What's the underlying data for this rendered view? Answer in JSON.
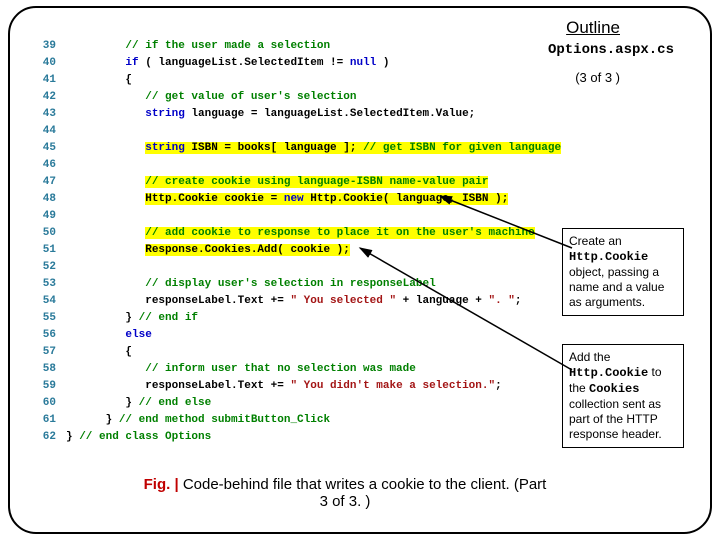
{
  "header": {
    "outline": "Outline",
    "filename": "Options.aspx.cs",
    "pageinfo": "(3 of 3 )"
  },
  "code": {
    "lines": [
      {
        "n": "39",
        "segs": [
          {
            "cls": "cmt",
            "t": "// if the user made a selection"
          }
        ],
        "indent": 3
      },
      {
        "n": "40",
        "segs": [
          {
            "cls": "kw",
            "t": "if"
          },
          {
            "cls": "plain",
            "t": " ( languageList.SelectedItem != "
          },
          {
            "cls": "kw",
            "t": "null"
          },
          {
            "cls": "plain",
            "t": " )"
          }
        ],
        "indent": 3
      },
      {
        "n": "41",
        "segs": [
          {
            "cls": "plain",
            "t": "{"
          }
        ],
        "indent": 3
      },
      {
        "n": "42",
        "segs": [
          {
            "cls": "cmt",
            "t": "// get value of user's selection"
          }
        ],
        "indent": 4
      },
      {
        "n": "43",
        "segs": [
          {
            "cls": "kw",
            "t": "string"
          },
          {
            "cls": "plain",
            "t": " language = languageList.SelectedItem.Value;"
          }
        ],
        "indent": 4
      },
      {
        "n": "44",
        "segs": [],
        "indent": 0
      },
      {
        "n": "45",
        "segs": [
          {
            "cls": "kw hl",
            "t": "string"
          },
          {
            "cls": "plain hl",
            "t": " ISBN = books[ language ]; "
          },
          {
            "cls": "cmt hl",
            "t": "// get ISBN for given language"
          }
        ],
        "indent": 4
      },
      {
        "n": "46",
        "segs": [],
        "indent": 0
      },
      {
        "n": "47",
        "segs": [
          {
            "cls": "cmt hl",
            "t": "// create cookie using language-ISBN name-value pair"
          }
        ],
        "indent": 4
      },
      {
        "n": "48",
        "segs": [
          {
            "cls": "plain hl",
            "t": "Http.Cookie cookie = "
          },
          {
            "cls": "kw hl",
            "t": "new"
          },
          {
            "cls": "plain hl",
            "t": " Http.Cookie( language, ISBN );"
          }
        ],
        "indent": 4
      },
      {
        "n": "49",
        "segs": [],
        "indent": 0
      },
      {
        "n": "50",
        "segs": [
          {
            "cls": "cmt hl",
            "t": "// add cookie to response to place it on the user's machine"
          }
        ],
        "indent": 4
      },
      {
        "n": "51",
        "segs": [
          {
            "cls": "plain hl",
            "t": "Response.Cookies.Add( cookie );"
          }
        ],
        "indent": 4
      },
      {
        "n": "52",
        "segs": [],
        "indent": 0
      },
      {
        "n": "53",
        "segs": [
          {
            "cls": "cmt",
            "t": "// display user's selection in responseLabel"
          }
        ],
        "indent": 4
      },
      {
        "n": "54",
        "segs": [
          {
            "cls": "plain",
            "t": "responseLabel.Text += "
          },
          {
            "cls": "str",
            "t": "\" You selected \""
          },
          {
            "cls": "plain",
            "t": " + language + "
          },
          {
            "cls": "str",
            "t": "\". \""
          },
          {
            "cls": "plain",
            "t": ";"
          }
        ],
        "indent": 4
      },
      {
        "n": "55",
        "segs": [
          {
            "cls": "plain",
            "t": "} "
          },
          {
            "cls": "cmt",
            "t": "// end if"
          }
        ],
        "indent": 3
      },
      {
        "n": "56",
        "segs": [
          {
            "cls": "kw",
            "t": "else"
          }
        ],
        "indent": 3
      },
      {
        "n": "57",
        "segs": [
          {
            "cls": "plain",
            "t": "{"
          }
        ],
        "indent": 3
      },
      {
        "n": "58",
        "segs": [
          {
            "cls": "cmt",
            "t": "// inform user that no selection was made"
          }
        ],
        "indent": 4
      },
      {
        "n": "59",
        "segs": [
          {
            "cls": "plain",
            "t": "responseLabel.Text += "
          },
          {
            "cls": "str",
            "t": "\" You didn't make a selection.\""
          },
          {
            "cls": "plain",
            "t": ";"
          }
        ],
        "indent": 4
      },
      {
        "n": "60",
        "segs": [
          {
            "cls": "plain",
            "t": "} "
          },
          {
            "cls": "cmt",
            "t": "// end else"
          }
        ],
        "indent": 3
      },
      {
        "n": "61",
        "segs": [
          {
            "cls": "plain",
            "t": "} "
          },
          {
            "cls": "cmt",
            "t": "// end method submitButton_Click"
          }
        ],
        "indent": 2
      },
      {
        "n": "62",
        "segs": [
          {
            "cls": "plain",
            "t": "} "
          },
          {
            "cls": "cmt",
            "t": "// end class Options"
          }
        ],
        "indent": 0
      }
    ]
  },
  "callouts": {
    "c1": {
      "p1": "Create an",
      "mono": "Http.Cookie",
      "p2": "object, passing a name and a value as arguments."
    },
    "c2": {
      "p1a": "Add the ",
      "mono1": "Http.Cookie",
      "p1b": " to the ",
      "mono2": "Cookies",
      "p2": "collection sent as part of the HTTP response header."
    }
  },
  "caption": {
    "fig": "Fig. |",
    "text": " Code-behind file that writes a cookie to the client. (Part 3 of 3. )"
  }
}
